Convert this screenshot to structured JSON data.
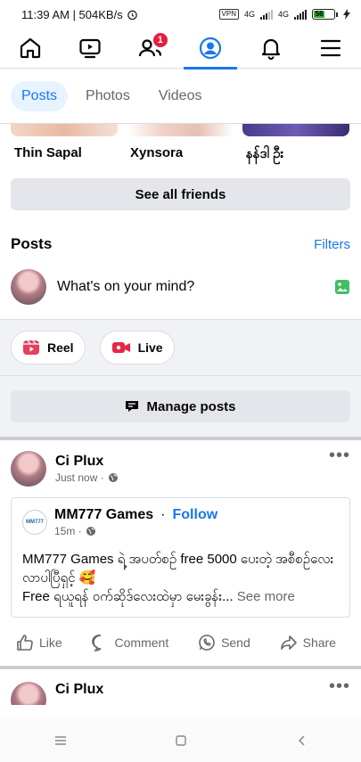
{
  "status": {
    "time_speed": "11:39 AM | 504KB/s",
    "vpn": "VPN",
    "net1": "4G",
    "net2": "4G",
    "battery": "56"
  },
  "nav": {
    "friends_badge": "1"
  },
  "subtabs": [
    "Posts",
    "Photos",
    "Videos"
  ],
  "friends": [
    "Thin Sapal",
    "Xynsora",
    "နန်ဒါ ဦး"
  ],
  "see_all_friends": "See all friends",
  "posts_section": {
    "title": "Posts",
    "filters": "Filters"
  },
  "composer": {
    "placeholder": "What's on your mind?"
  },
  "chips": {
    "reel": "Reel",
    "live": "Live"
  },
  "manage_posts": "Manage posts",
  "post": {
    "author": "Ci Plux",
    "time": "Just now ·",
    "shared": {
      "page": "MM777 Games",
      "dot": "·",
      "follow": "Follow",
      "time": "15m ·",
      "line1": "MM777 Games ရဲ့ အပတ်စဉ် free 5000 ပေးတဲ့ အစီစဉ်လေးလာပါပြီရှင့် 🥰",
      "line2": "Free ရယူရန် ဝက်ဆိုဒ်လေးထဲမှာ မေးခွန်း...",
      "see_more": "See more",
      "logo_text": "MM777"
    },
    "actions": {
      "like": "Like",
      "comment": "Comment",
      "send": "Send",
      "share": "Share"
    }
  },
  "post2": {
    "author": "Ci Plux"
  },
  "colors": {
    "accent": "#1877f2",
    "badge": "#e41e3f"
  }
}
